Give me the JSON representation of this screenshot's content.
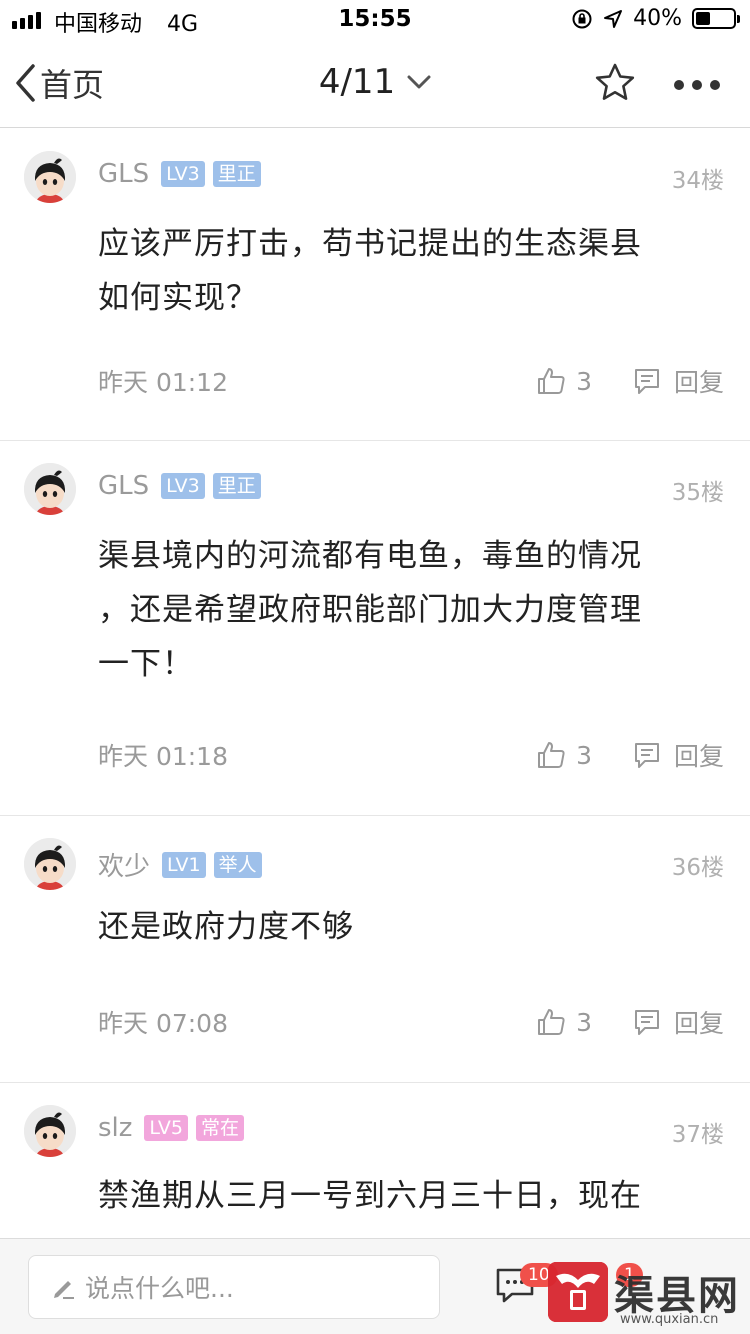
{
  "status_bar": {
    "carrier": "中国移动",
    "network": "4G",
    "time": "15:55",
    "battery": "40%",
    "battery_level": 0.4
  },
  "nav": {
    "back_label": "首页",
    "page_indicator": "4/11"
  },
  "comments": [
    {
      "author": "GLS",
      "level": "LV3",
      "title": "里正",
      "badge_color": "#9ec0ea",
      "floor": "34楼",
      "text_lines": [
        "应该严厉打击，苟书记提出的生态渠县",
        "如何实现？"
      ],
      "time": "昨天 01:12",
      "likes": "3",
      "reply_label": "回复"
    },
    {
      "author": "GLS",
      "level": "LV3",
      "title": "里正",
      "badge_color": "#9ec0ea",
      "floor": "35楼",
      "text_lines": [
        "渠县境内的河流都有电鱼，毒鱼的情况",
        "，还是希望政府职能部门加大力度管理",
        "一下！"
      ],
      "time": "昨天 01:18",
      "likes": "3",
      "reply_label": "回复"
    },
    {
      "author": "欢少",
      "level": "LV1",
      "title": "举人",
      "badge_color": "#9ec0ea",
      "floor": "36楼",
      "text_lines": [
        "还是政府力度不够"
      ],
      "time": "昨天 07:08",
      "likes": "3",
      "reply_label": "回复"
    },
    {
      "author": "slz",
      "level": "LV5",
      "title": "常在",
      "badge_color": "#f2a6dc",
      "floor": "37楼",
      "text_lines": [
        "禁渔期从三月一号到六月三十日，现在"
      ],
      "time": "",
      "likes": "",
      "reply_label": ""
    }
  ],
  "bottom_bar": {
    "input_placeholder": "说点什么吧...",
    "comments_badge": "10",
    "second_badge": "1"
  },
  "watermark": {
    "site_name": "渠县网",
    "url": "www.quxian.cn",
    "logo_text": "渠县"
  }
}
